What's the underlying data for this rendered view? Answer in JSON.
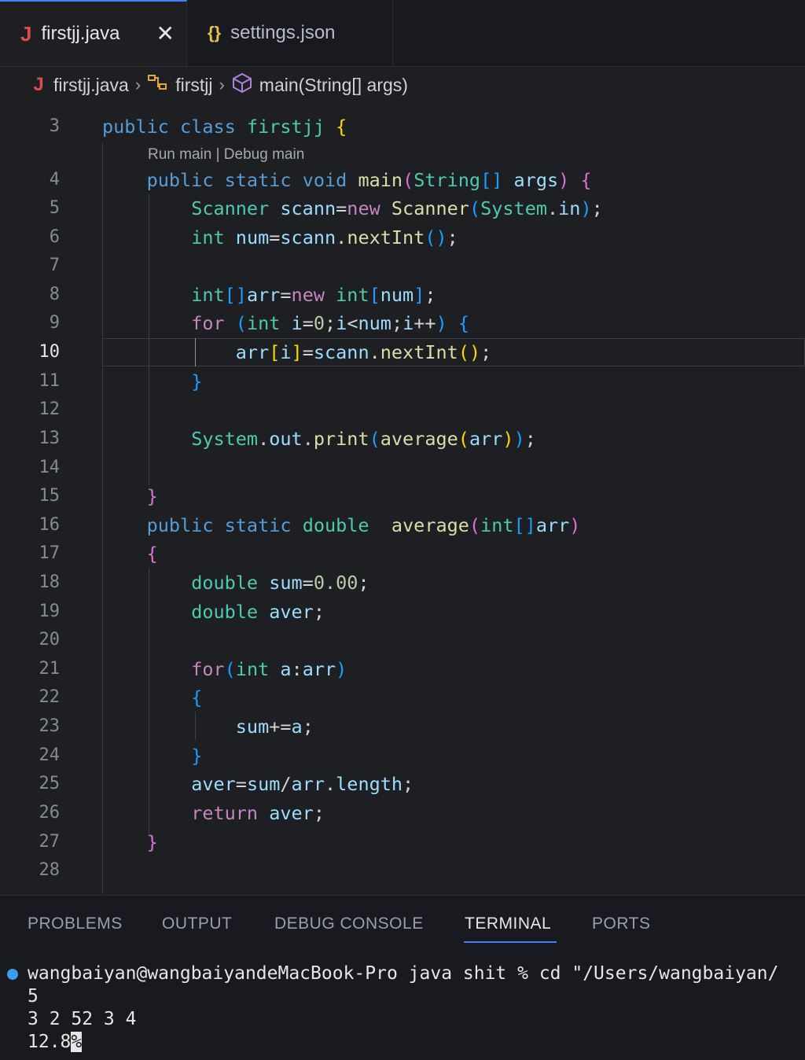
{
  "tabs": [
    {
      "label": "firstjj.java",
      "icon": "J",
      "active": true
    },
    {
      "label": "settings.json",
      "icon": "{}",
      "active": false
    }
  ],
  "breadcrumb": {
    "file": "firstjj.java",
    "class": "firstjj",
    "method": "main(String[] args)"
  },
  "editor": {
    "codelens": "Run main | Debug main",
    "current_line": "10",
    "line_numbers": [
      "3",
      "4",
      "5",
      "6",
      "7",
      "8",
      "9",
      "10",
      "11",
      "12",
      "13",
      "14",
      "15",
      "16",
      "17",
      "18",
      "19",
      "20",
      "21",
      "22",
      "23",
      "24",
      "25",
      "26",
      "27",
      "28"
    ],
    "code": [
      "public class firstjj {",
      "    public static void main(String[] args) {",
      "        Scanner scann=new Scanner(System.in);",
      "        int num=scann.nextInt();",
      "",
      "        int[]arr=new int[num];",
      "        for (int i=0;i<num;i++) {",
      "            arr[i]=scann.nextInt();",
      "        }",
      "",
      "        System.out.print(average(arr));",
      "",
      "    }",
      "    public static double  average(int[]arr)",
      "    {",
      "        double sum=0.00;",
      "        double aver;",
      "",
      "        for(int a:arr)",
      "        {",
      "            sum+=a;",
      "        }",
      "        aver=sum/arr.length;",
      "        return aver;",
      "    }",
      ""
    ]
  },
  "panel": {
    "tabs": [
      "PROBLEMS",
      "OUTPUT",
      "DEBUG CONSOLE",
      "TERMINAL",
      "PORTS"
    ],
    "active_tab": "TERMINAL",
    "terminal_lines": [
      "wangbaiyan@wangbaiyandeMacBook-Pro java shit % cd \"/Users/wangbaiyan/",
      "5",
      "3 2 52 3 4",
      "12.8"
    ],
    "percent_marker": "%"
  },
  "colors": {
    "background": "#1e1f22",
    "accent": "#3b82f6",
    "keyword": "#569cd6",
    "type": "#4ec9b0",
    "function": "#dcdcaa"
  }
}
